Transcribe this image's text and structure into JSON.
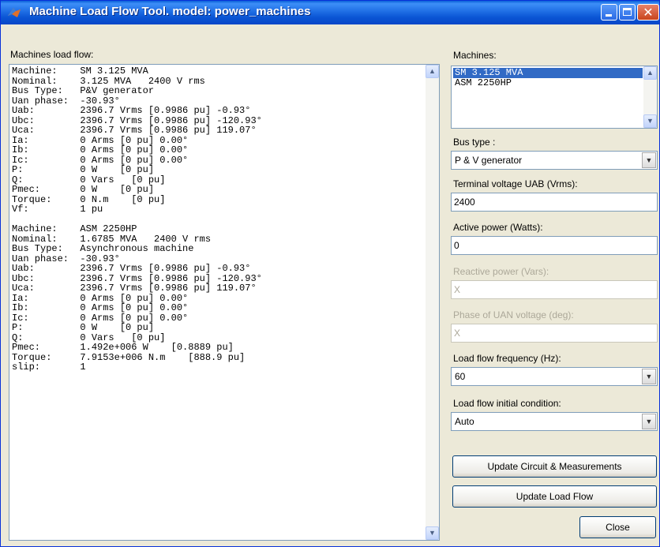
{
  "window": {
    "title": "Machine Load Flow Tool. model: power_machines",
    "close_glyph": "✕",
    "icons": {
      "app": "matlab-icon",
      "minimize": "minimize-icon",
      "maximize": "maximize-icon",
      "close": "close-icon"
    }
  },
  "load_flow": {
    "label": "Machines load flow:",
    "text": "Machine:    SM 3.125 MVA\nNominal:    3.125 MVA   2400 V rms\nBus Type:   P&V generator\nUan phase:  -30.93°\nUab:        2396.7 Vrms [0.9986 pu] -0.93°\nUbc:        2396.7 Vrms [0.9986 pu] -120.93°\nUca:        2396.7 Vrms [0.9986 pu] 119.07°\nIa:         0 Arms [0 pu] 0.00°\nIb:         0 Arms [0 pu] 0.00°\nIc:         0 Arms [0 pu] 0.00°\nP:          0 W    [0 pu]\nQ:          0 Vars   [0 pu]\nPmec:       0 W    [0 pu]\nTorque:     0 N.m    [0 pu]\nVf:         1 pu\n\nMachine:    ASM 2250HP\nNominal:    1.6785 MVA   2400 V rms\nBus Type:   Asynchronous machine\nUan phase:  -30.93°\nUab:        2396.7 Vrms [0.9986 pu] -0.93°\nUbc:        2396.7 Vrms [0.9986 pu] -120.93°\nUca:        2396.7 Vrms [0.9986 pu] 119.07°\nIa:         0 Arms [0 pu] 0.00°\nIb:         0 Arms [0 pu] 0.00°\nIc:         0 Arms [0 pu] 0.00°\nP:          0 W    [0 pu]\nQ:          0 Vars   [0 pu]\nPmec:       1.492e+006 W    [0.8889 pu]\nTorque:     7.9153e+006 N.m    [888.9 pu]\nslip:       1"
  },
  "machines": {
    "label": "Machines:",
    "items": [
      "SM 3.125 MVA",
      "ASM 2250HP"
    ],
    "selected_index": 0
  },
  "bus_type": {
    "label": "Bus type :",
    "value": "P & V generator"
  },
  "terminal_voltage": {
    "label": "Terminal voltage UAB (Vrms):",
    "value": "2400"
  },
  "active_power": {
    "label": "Active power (Watts):",
    "value": "0"
  },
  "reactive_power": {
    "label": "Reactive power (Vars):",
    "value": "X",
    "disabled": true
  },
  "phase_uan": {
    "label": "Phase of UAN voltage (deg):",
    "value": "X",
    "disabled": true
  },
  "frequency": {
    "label": "Load flow frequency (Hz):",
    "value": "60"
  },
  "initial_condition": {
    "label": "Load flow initial condition:",
    "value": "Auto"
  },
  "buttons": {
    "update_circuit": "Update Circuit & Measurements",
    "update_load_flow": "Update Load Flow",
    "close": "Close"
  },
  "scroll_glyphs": {
    "up": "▲",
    "down": "▼"
  },
  "colors": {
    "titlebar": "#0a55d4",
    "selection": "#316ac5",
    "dialog_bg": "#ece9d8",
    "field_border": "#7f9db9",
    "disabled_text": "#aca899"
  }
}
